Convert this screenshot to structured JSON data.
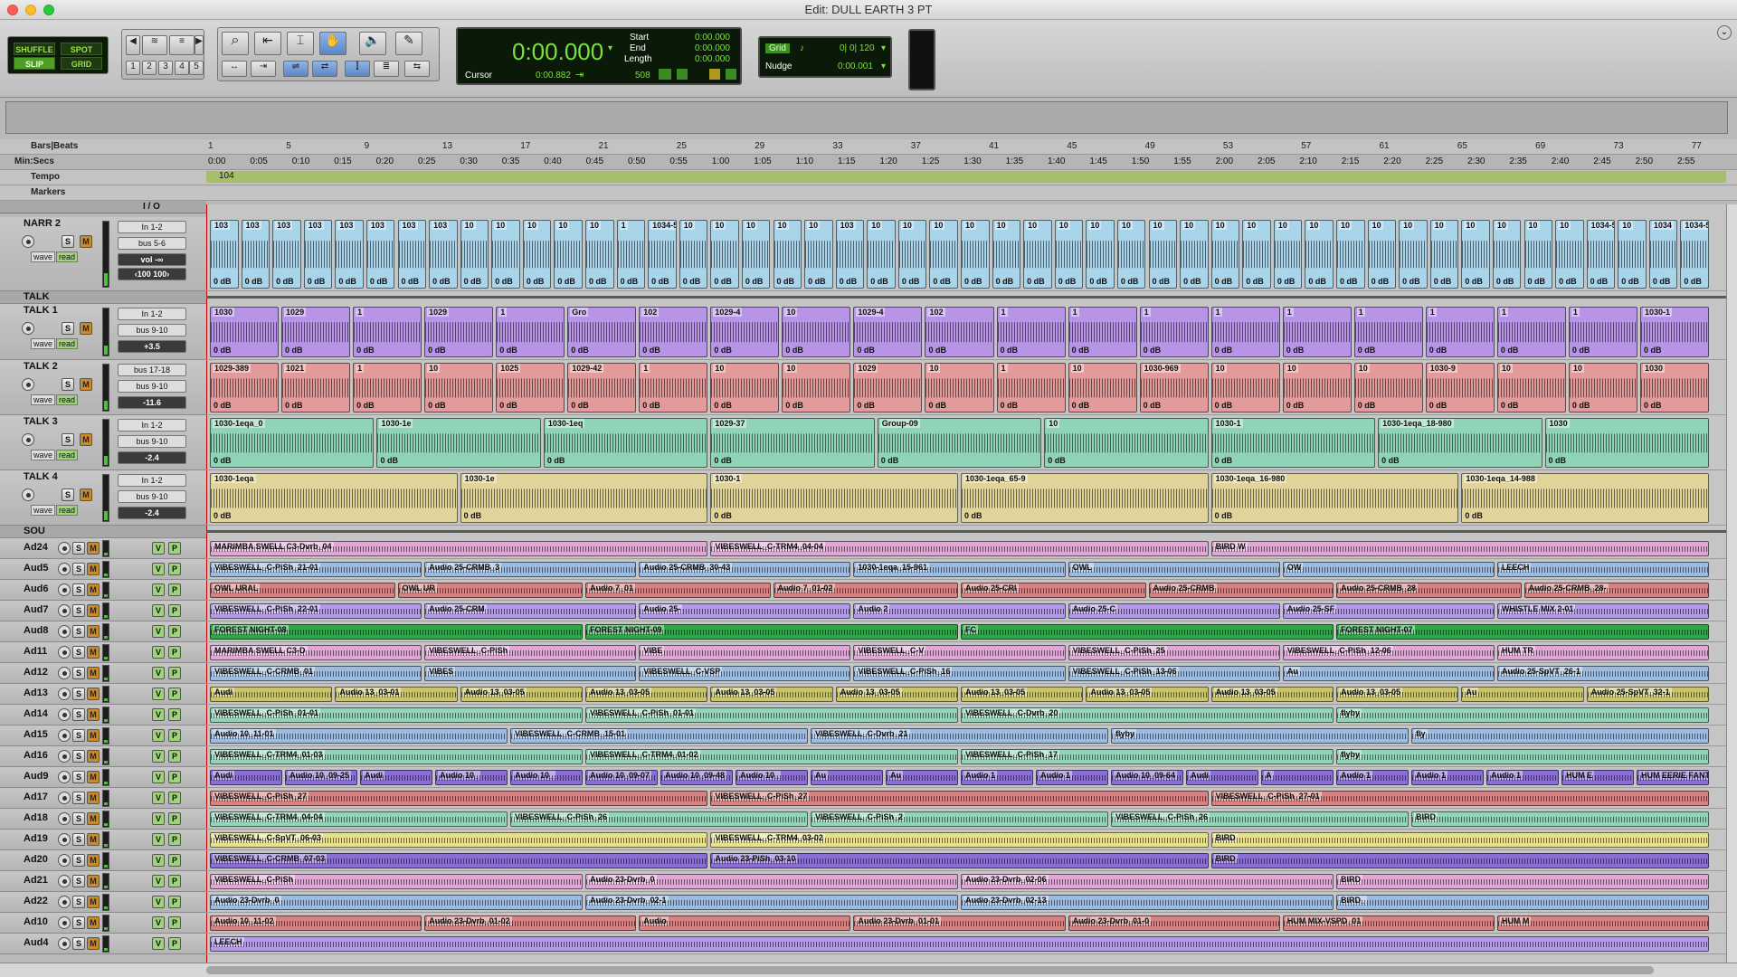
{
  "window": {
    "title": "Edit: DULL EARTH 3 PT"
  },
  "modes": {
    "shuffle": "SHUFFLE",
    "spot": "SPOT",
    "slip": "SLIP",
    "grid": "GRID"
  },
  "zoom_presets": [
    "1",
    "2",
    "3",
    "4",
    "5"
  ],
  "counter": {
    "main": "0:00.000",
    "start_label": "Start",
    "start": "0:00.000",
    "end_label": "End",
    "end": "0:00.000",
    "length_label": "Length",
    "length": "0:00.000",
    "cursor_label": "Cursor",
    "cursor": "0:00.882",
    "samples": "508"
  },
  "grid": {
    "label": "Grid",
    "value": "0| 0| 120",
    "nudge_label": "Nudge",
    "nudge": "0:00.001"
  },
  "rulers": {
    "bars_label": "Bars|Beats",
    "minsecs_label": "Min:Secs",
    "tempo_label": "Tempo",
    "markers_label": "Markers",
    "tempo_value": "104",
    "bars": [
      "1",
      "5",
      "9",
      "13",
      "17",
      "21",
      "25",
      "29",
      "33",
      "37",
      "41",
      "45",
      "49",
      "53",
      "57",
      "61",
      "65",
      "69",
      "73",
      "77"
    ],
    "secs": [
      "0:00",
      "0:05",
      "0:10",
      "0:15",
      "0:20",
      "0:25",
      "0:30",
      "0:35",
      "0:40",
      "0:45",
      "0:50",
      "0:55",
      "1:00",
      "1:05",
      "1:10",
      "1:15",
      "1:20",
      "1:25",
      "1:30",
      "1:35",
      "1:40",
      "1:45",
      "1:50",
      "1:55",
      "2:00",
      "2:05",
      "2:10",
      "2:15",
      "2:20",
      "2:25",
      "2:30",
      "2:35",
      "2:40",
      "2:45",
      "2:50",
      "2:55"
    ]
  },
  "io_header": "I / O",
  "tracks": {
    "narr2": {
      "name": "NARR 2",
      "input": "In 1-2",
      "output": "bus 5-6",
      "view": "wave",
      "mode": "read",
      "vol_label": "vol",
      "vol": "-∞",
      "pan_l": "‹100",
      "pan_r": "100›"
    },
    "talk_folder": {
      "name": "TALK"
    },
    "talk1": {
      "name": "TALK 1",
      "input": "In 1-2",
      "output": "bus 9-10",
      "view": "wave",
      "mode": "read",
      "vol": "+3.5"
    },
    "talk2": {
      "name": "TALK 2",
      "input": "bus 17-18",
      "output": "bus 9-10",
      "view": "wave",
      "mode": "read",
      "vol": "-11.6"
    },
    "talk3": {
      "name": "TALK 3",
      "input": "In 1-2",
      "output": "bus 9-10",
      "view": "wave",
      "mode": "read",
      "vol": "-2.4"
    },
    "talk4": {
      "name": "TALK 4",
      "input": "In 1-2",
      "output": "bus 9-10",
      "view": "wave",
      "mode": "read",
      "vol": "-2.4"
    },
    "sou_folder": {
      "name": "SOU"
    },
    "small": [
      "Ad24",
      "Aud5",
      "Aud6",
      "Aud7",
      "Aud8",
      "Ad11",
      "Ad12",
      "Ad13",
      "Ad14",
      "Ad15",
      "Ad16",
      "Aud9",
      "Ad17",
      "Ad18",
      "Ad19",
      "Ad20",
      "Ad21",
      "Ad22",
      "Ad10",
      "Aud4"
    ],
    "buttons": {
      "s": "S",
      "m": "M",
      "v": "V",
      "p": "P"
    }
  },
  "clips": {
    "narr2": [
      "103",
      "103",
      "103",
      "103",
      "103",
      "103",
      "103",
      "103",
      "10",
      "10",
      "10",
      "10",
      "10",
      "1",
      "1034-509",
      "10",
      "10",
      "10",
      "10",
      "10",
      "103",
      "10",
      "10",
      "10",
      "10",
      "10",
      "10",
      "10",
      "10",
      "10",
      "10",
      "10",
      "10",
      "10",
      "10",
      "10",
      "10",
      "10",
      "10",
      "10",
      "10",
      "10",
      "10",
      "10",
      "1034-530",
      "10",
      "1034",
      "1034-534"
    ],
    "talk1": [
      "1030",
      "1029",
      "1",
      "1029",
      "1",
      "Gro",
      "102",
      "1029-4",
      "10",
      "1029-4",
      "102",
      "1",
      "1",
      "1",
      "1",
      "1",
      "1",
      "1",
      "1",
      "1",
      "1030-1"
    ],
    "talk2": [
      "1029-389",
      "1021",
      "1",
      "10",
      "1025",
      "1029-42",
      "1",
      "10",
      "10",
      "1029",
      "10",
      "1",
      "10",
      "1030-969",
      "10",
      "10",
      "10",
      "1030-9",
      "10",
      "10",
      "1030"
    ],
    "talk3": [
      "1030-1eqa_0",
      "1030-1e",
      "1030-1eq",
      "1029-37",
      "Group-09",
      "10",
      "1030-1",
      "1030-1eqa_18-980",
      "1030"
    ],
    "talk4": [
      "1030-1eqa",
      "1030-1e",
      "1030-1",
      "1030-1eqa_65-9",
      "1030-1eqa_16-980",
      "1030-1eqa_14-988"
    ],
    "db": "0 dB",
    "ad24": [
      "MARIMBA SWELL C3-Dvrb_04",
      "VIBESWELL_C-TRM4_04-04",
      "BIRD W"
    ],
    "aud5": [
      "VIBESWELL_C-PiSh_21-01",
      "Audio 25-CRMB_3",
      "Audio 25-CRMB_30-43",
      "1030-1eqa_15-961",
      "OWL",
      "OW",
      "LEECH"
    ],
    "aud6": [
      "OWL URAL",
      "OWL UR",
      "Audio 7_01",
      "Audio 7_01-02",
      "Audio 25-CRI",
      "Audio 25-CRMB",
      "Audio 25-CRMB_28",
      "Audio 25-CRMB_28-"
    ],
    "aud7": [
      "VIBESWELL_C-PiSh_22-01",
      "Audio 25-CRM",
      "Audio 25-",
      "Audio 2",
      "Audio 25-C",
      "Audio 25-SF",
      "WHISTLE MIX 2-01"
    ],
    "aud8": [
      "FOREST NIGHT-08",
      "FOREST NIGHT-09",
      "FC",
      "FOREST NIGHT-07"
    ],
    "ad11": [
      "MARIMBA SWELL C3-D",
      "VIBESWELL_C-PiSh",
      "VIBE",
      "VIBESWELL_C-V",
      "VIBESWELL_C-PiSh_25",
      "VIBESWELL_C-PiSh_12-06",
      "HUM TR"
    ],
    "ad12": [
      "VIBESWELL_C-CRMB_01",
      "VIBES",
      "VIBESWELL_C-VSP",
      "VIBESWELL_C-PiSh_16",
      "VIBESWELL_C-PiSh_13-06",
      "Au",
      "Audio 25-SpVT_26-1"
    ],
    "ad13": [
      "Audi",
      "Audio 13_03-01",
      "Audio 13_03-05",
      "Audio 13_03-05",
      "Audio 13_03-05",
      "Audio 13_03-05",
      "Audio 13_03-05",
      "Audio 13_03-05",
      "Audio 13_03-05",
      "Audio 13_03-05",
      "Au",
      "Audio 25-SpVT_32-1"
    ],
    "ad14": [
      "VIBESWELL_C-PiSh_01-01",
      "VIBESWELL_C-PiSh_01-01",
      "VIBESWELL_C-Dvrb_20",
      "flyby"
    ],
    "ad15": [
      "Audio 10_11-01",
      "VIBESWELL_C-CRMB_15-01",
      "VIBESWELL_C-Dvrb_21",
      "flyby",
      "fly"
    ],
    "ad16": [
      "VIBESWELL_C-TRM4_01-03",
      "VIBESWELL_C-TRM4_01-02",
      "VIBESWELL_C-PiSh_17",
      "flyby"
    ],
    "aud9": [
      "Audi",
      "Audio 10_09-25",
      "Audi",
      "Audio 10_",
      "Audio 10_",
      "Audio 10_09-07",
      "Audio 10_09-48",
      "Audio 10_",
      "Au",
      "Au",
      "Audio 1",
      "Audio 1",
      "Audio 10_09-64",
      "Audi",
      "A",
      "Audio 1",
      "Audio 1",
      "Audio 1",
      "HUM E",
      "HUM EERIE FANTAS"
    ],
    "ad17": [
      "VIBESWELL_C-PiSh_27",
      "VIBESWELL_C-PiSh_27",
      "VIBESWELL_C-PiSh_27-01"
    ],
    "ad18": [
      "VIBESWELL_C-TRM4_04-04",
      "VIBESWELL_C-PiSh_26",
      "VIBESWELL_C-PiSh_2",
      "VIBESWELL_C-PiSh_26",
      "BIRD"
    ],
    "ad19": [
      "VIBESWELL_C-SpVT_06-03",
      "VIBESWELL_C-TRM4_03-02",
      "BIRD"
    ],
    "ad20": [
      "VIBESWELL_C-CRMB_07-03",
      "Audio 23-PiSh_03-10",
      "BIRD"
    ],
    "ad21": [
      "VIBESWELL_C-PiSh",
      "Audio 23-Dvrb_0",
      "Audio 23-Dvrb_02-06",
      "BIRD"
    ],
    "ad22": [
      "Audio 23-Dvrb_0",
      "Audio 23-Dvrb_02-1",
      "Audio 23-Dvrb_02-13",
      "BIRD_"
    ],
    "ad10": [
      "Audio 10_11-02",
      "Audio 23-Dvrb_01-02",
      "Audio",
      "Audio 23-Dvrb_01-01",
      "Audio 23-Dvrb_01-0",
      "HUM MIX-VSPD_01",
      "HUM M"
    ],
    "aud4": [
      "LEECH"
    ]
  },
  "colors": {
    "narr": "#a9d4ea",
    "talk1": "#b894e6",
    "talk2": "#e39a9a",
    "talk3": "#8fd4b6",
    "talk4": "#e0d49a",
    "pink": "#e0a6d6",
    "blue": "#9cbbe0",
    "red": "#d98080",
    "purple": "#b39ae6",
    "green": "#2fa84a",
    "olive": "#c9c46a",
    "teal": "#92d4b8",
    "yellow": "#e9e18a",
    "violet": "#8a6ed6"
  }
}
